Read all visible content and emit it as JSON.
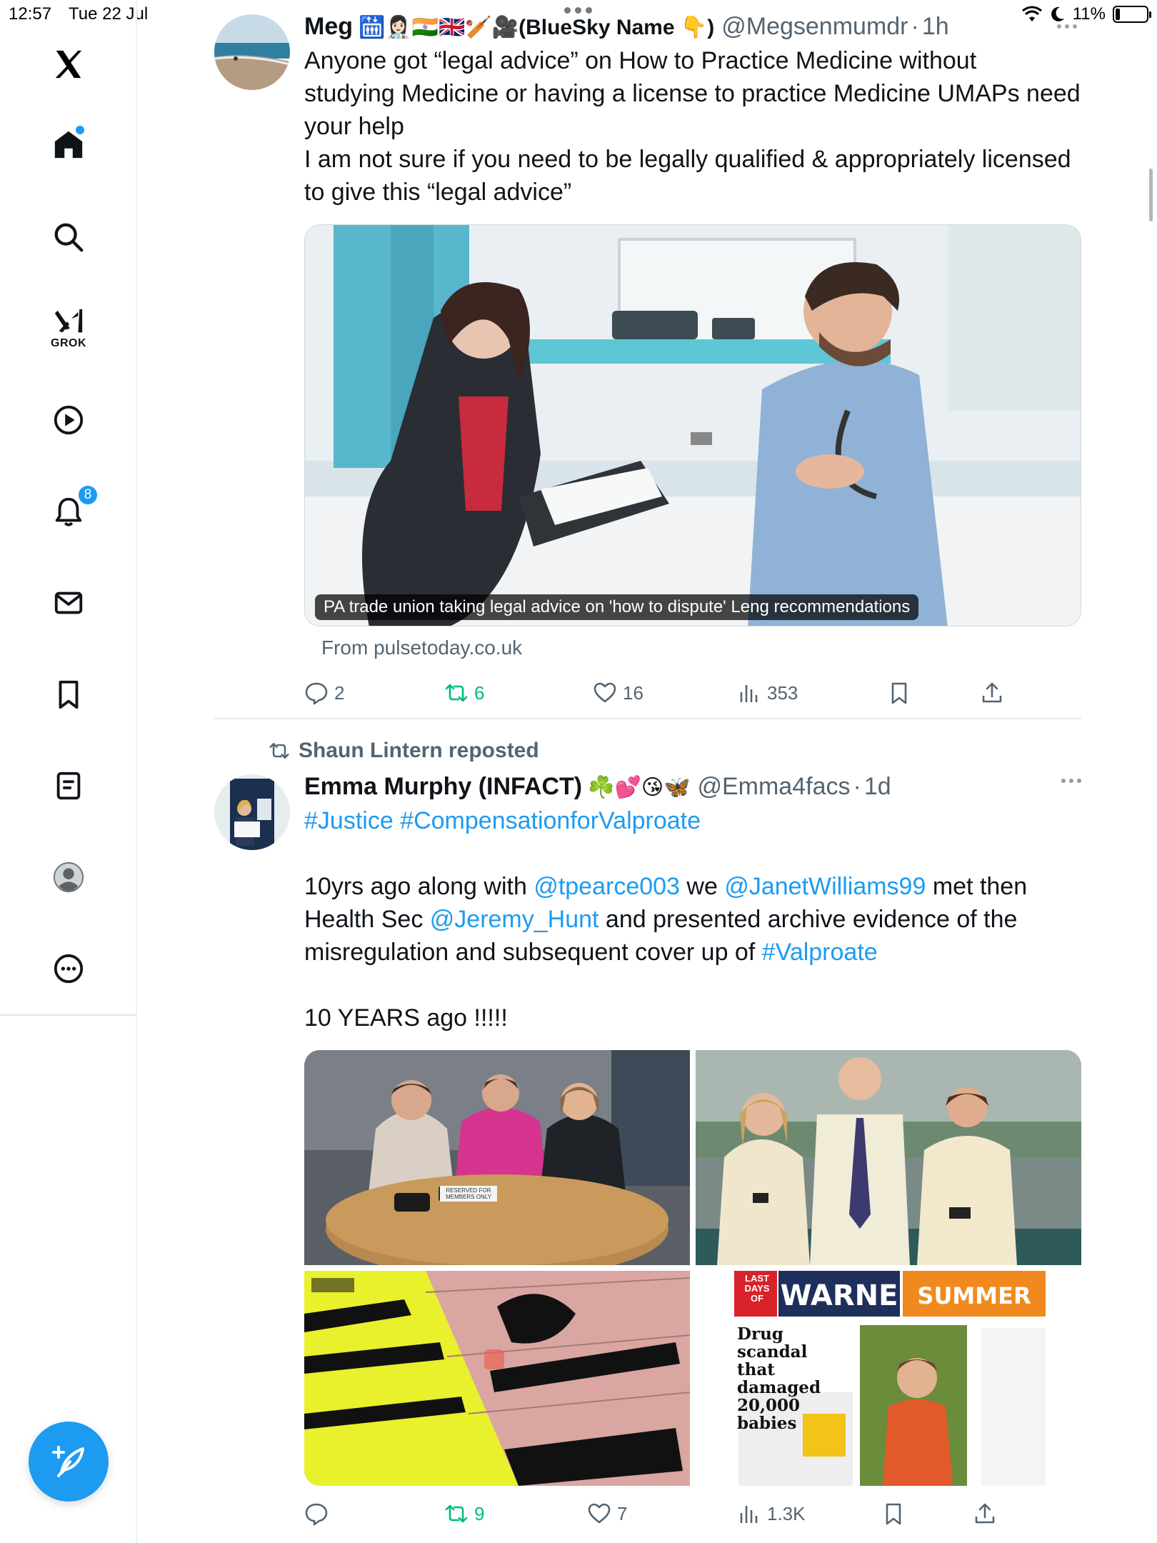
{
  "status_bar": {
    "time": "12:57",
    "date": "Tue 22 Jul",
    "battery": "11%"
  },
  "sidebar": {
    "logo": "𝕏",
    "grok_label": "GROK",
    "notifications_badge": "8",
    "icons": [
      "x-logo-icon",
      "home-icon",
      "search-icon",
      "grok-icon",
      "video-icon",
      "bell-icon",
      "mail-icon",
      "bookmark-icon",
      "list-icon",
      "profile-icon",
      "more-icon",
      "compose-icon"
    ]
  },
  "tweets": [
    {
      "name": "Meg",
      "emojis": "🛗👩🏻‍⚕️🇮🇳🇬🇧🏏🎥(BlueSky Name 👇)",
      "handle": "@Megsenmumdr",
      "sep": "·",
      "time": "1h",
      "text_lines": [
        "Anyone got “legal advice” on How to Practice Medicine without",
        "studying Medicine or having a license to practice Medicine UMAPs need",
        "your help",
        "I am not sure if you need to be legally qualified & appropriately licensed",
        "to give this “legal advice”"
      ],
      "card": {
        "caption": "PA trade union taking legal advice on 'how to dispute' Leng recommendations",
        "source": "From pulsetoday.co.uk"
      },
      "actions": {
        "replies": "2",
        "reposts": "6",
        "likes": "16",
        "views": "353"
      }
    },
    {
      "reposted_by": "Shaun Lintern reposted",
      "name": "Emma Murphy (INFACT)",
      "emojis": "☘️💕😘🦋",
      "handle": "@Emma4facs",
      "sep": "·",
      "time": "1d",
      "hashtags": {
        "tag1": "#Justice",
        "tag2": "#CompensationforValproate"
      },
      "para": {
        "t1": "10yrs ago along with ",
        "m1": "@tpearce003",
        "t2": " we ",
        "m2": "@JanetWilliams99",
        "t3": " met then",
        "t4": "Health Sec ",
        "m3": "@Jeremy_Hunt",
        "t5": " and presented archive evidence of the",
        "t6": "misregulation and subsequent cover up of ",
        "m4": "#Valproate"
      },
      "last_line": "10 YEARS ago !!!!!",
      "images": {
        "img1_sign": "RESERVED FOR MEMBERS ONLY",
        "img4_headline1": "Drug scandal",
        "img4_headline2": "that damaged",
        "img4_headline3": "20,000 babies",
        "img4_banner_left": "LAST DAYS OF",
        "img4_banner_mid": "WARNE",
        "img4_banner_right": "SUMMER"
      },
      "actions": {
        "replies": "",
        "reposts": "9",
        "likes": "7",
        "views": "1.3K"
      }
    }
  ]
}
